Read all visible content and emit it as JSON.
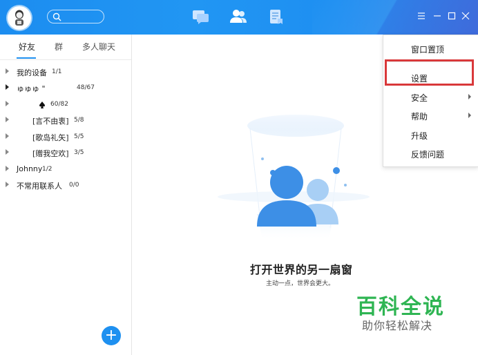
{
  "topbar": {
    "search_placeholder": "",
    "nav_icons": [
      "message-icon",
      "contacts-icon",
      "space-icon"
    ],
    "window_controls": [
      "menu-icon",
      "minimize-icon",
      "maximize-icon",
      "close-icon"
    ],
    "accent": "#1e90f0"
  },
  "sidebar": {
    "tabs": [
      {
        "label": "好友",
        "active": true
      },
      {
        "label": "群",
        "active": false
      },
      {
        "label": "多人聊天",
        "active": false
      }
    ],
    "groups": [
      {
        "name": "我的设备",
        "count": "1/1"
      },
      {
        "name": "ゅゅゅ \"",
        "count": "48/67"
      },
      {
        "name": "",
        "count": "60/82"
      },
      {
        "name": "[言不由衷]",
        "count": "5/8"
      },
      {
        "name": "[歌岛礼矢]",
        "count": "5/5"
      },
      {
        "name": "[赠我空欢]",
        "count": "3/5"
      },
      {
        "name": "Johnny",
        "count": "1/2"
      },
      {
        "name": "不常用联系人",
        "count": "0/0"
      }
    ],
    "add_button": "+"
  },
  "main": {
    "tagline": "打开世界的另一扇窗",
    "subline": "主动一点，世界会更大。"
  },
  "menu": {
    "items": [
      {
        "label": "窗口置顶",
        "submenu": false
      },
      {
        "label": "设置",
        "submenu": false,
        "highlighted": true
      },
      {
        "label": "安全",
        "submenu": true
      },
      {
        "label": "帮助",
        "submenu": true
      },
      {
        "label": "升级",
        "submenu": false
      },
      {
        "label": "反馈问题",
        "submenu": false
      }
    ]
  },
  "watermark": {
    "title": "百科全说",
    "subtitle": "助你轻松解决"
  }
}
